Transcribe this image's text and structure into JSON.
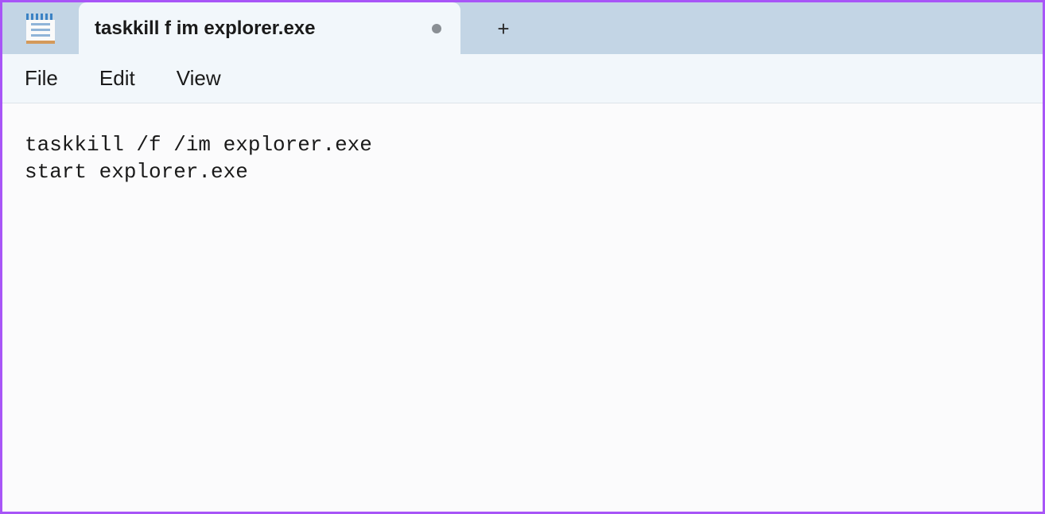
{
  "titlebar": {
    "tab_title": "taskkill f im explorer.exe",
    "is_dirty": true
  },
  "menubar": {
    "items": [
      "File",
      "Edit",
      "View"
    ]
  },
  "editor": {
    "content": "taskkill /f /im explorer.exe\nstart explorer.exe"
  }
}
